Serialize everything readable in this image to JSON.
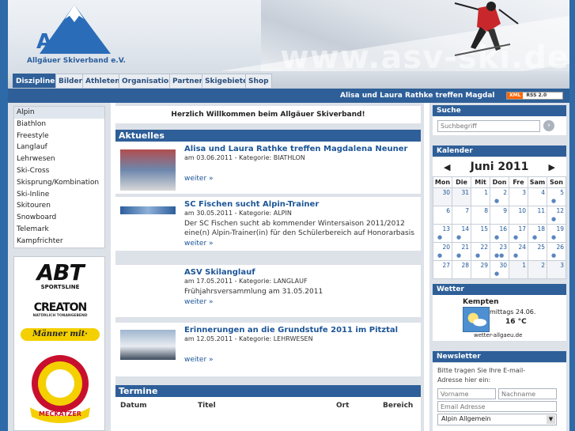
{
  "logo": {
    "abbr": "ASV",
    "subtitle": "Allgäuer Skiverband e.V."
  },
  "header": {
    "watermark": "www.asv-ski.de"
  },
  "nav": {
    "tabs": [
      "Disziplinen",
      "Bilder",
      "Athleten",
      "Organisation",
      "Partner",
      "Skigebiete",
      "Shop"
    ],
    "active": "Disziplinen"
  },
  "ticker": {
    "text": "Alisa und Laura Rathke treffen Magdalena Neuner"
  },
  "rss": {
    "xml": "XML",
    "label": "RSS 2.0"
  },
  "categories": [
    "Alpin",
    "Biathlon",
    "Freestyle",
    "Langlauf",
    "Lehrwesen",
    "Ski-Cross",
    "Skisprung/Kombination",
    "Ski-Inline",
    "Skitouren",
    "Snowboard",
    "Telemark",
    "Kampfrichter"
  ],
  "sponsors": {
    "abt": "ABT",
    "abt_sub": "SPORTSLINE",
    "creaton": "CREATON",
    "creaton_sub": "NATÜRLICH TONANGEBEND",
    "maenner": "Männer mit·",
    "meckatzer": "MECKATZER"
  },
  "welcome": "Herzlich Willkommen beim Allgäuer Skiverband!",
  "aktuelles": {
    "heading": "Aktuelles",
    "more_label": "weiter »",
    "articles": [
      {
        "title": "Alisa und Laura Rathke treffen Magdalena Neuner",
        "meta": "am 03.06.2011 - Kategorie: BIATHLON",
        "text": ""
      },
      {
        "title": "SC Fischen sucht Alpin-Trainer",
        "meta": "am 30.05.2011 - Kategorie: ALPIN",
        "text": "Der SC Fischen sucht ab kommender Wintersaison 2011/2012 eine(n) Alpin-Trainer(in) für den Schülerbereich auf Honorarbasis"
      },
      {
        "title": "ASV Skilanglauf",
        "meta": "am 17.05.2011 - Kategorie: LANGLAUF",
        "text": "Frühjahrsversammlung am 31.05.2011"
      },
      {
        "title": "Erinnerungen an die Grundstufe 2011 im Pitztal",
        "meta": "am 12.05.2011 - Kategorie: LEHRWESEN",
        "text": ""
      }
    ]
  },
  "termine": {
    "heading": "Termine",
    "columns": [
      "Datum",
      "Titel",
      "Ort",
      "Bereich"
    ]
  },
  "suche": {
    "heading": "Suche",
    "placeholder": "Suchbegriff",
    "button_icon": "go-arrow-icon"
  },
  "kalender": {
    "heading": "Kalender",
    "month": "Juni 2011",
    "prev": "◀",
    "next": "▶",
    "weekdays": [
      "Mon",
      "Die",
      "Mit",
      "Don",
      "Fre",
      "Sam",
      "Son"
    ],
    "weeks": [
      [
        {
          "d": "30",
          "m": true,
          "e": ""
        },
        {
          "d": "31",
          "m": true,
          "e": ""
        },
        {
          "d": "1",
          "e": ""
        },
        {
          "d": "2",
          "e": "●"
        },
        {
          "d": "3",
          "e": ""
        },
        {
          "d": "4",
          "e": ""
        },
        {
          "d": "5",
          "e": "●"
        }
      ],
      [
        {
          "d": "6",
          "e": ""
        },
        {
          "d": "7",
          "e": ""
        },
        {
          "d": "8",
          "e": ""
        },
        {
          "d": "9",
          "e": ""
        },
        {
          "d": "10",
          "e": ""
        },
        {
          "d": "11",
          "e": ""
        },
        {
          "d": "12",
          "e": "●"
        }
      ],
      [
        {
          "d": "13",
          "e": "●"
        },
        {
          "d": "14",
          "e": "●"
        },
        {
          "d": "15",
          "e": ""
        },
        {
          "d": "16",
          "e": "●"
        },
        {
          "d": "17",
          "e": "●"
        },
        {
          "d": "18",
          "e": "●"
        },
        {
          "d": "19",
          "e": "●"
        }
      ],
      [
        {
          "d": "20",
          "e": "●"
        },
        {
          "d": "21",
          "e": "●"
        },
        {
          "d": "22",
          "e": "●"
        },
        {
          "d": "23",
          "e": "●●"
        },
        {
          "d": "24",
          "e": "●"
        },
        {
          "d": "25",
          "e": ""
        },
        {
          "d": "26",
          "e": "●"
        }
      ],
      [
        {
          "d": "27",
          "e": ""
        },
        {
          "d": "28",
          "e": ""
        },
        {
          "d": "29",
          "e": ""
        },
        {
          "d": "30",
          "e": "●"
        },
        {
          "d": "1",
          "m": true,
          "e": ""
        },
        {
          "d": "2",
          "m": true,
          "e": ""
        },
        {
          "d": "3",
          "m": true,
          "e": ""
        }
      ]
    ]
  },
  "wetter": {
    "heading": "Wetter",
    "city": "Kempten",
    "date": "mittags 24.06.",
    "temp": "16 °C",
    "source": "wetter-allgaeu.de"
  },
  "newsletter": {
    "heading": "Newsletter",
    "text": "Bitte tragen Sie Ihre E-mail-Adresse hier ein:",
    "firstname": "Vorname",
    "lastname": "Nachname",
    "email": "Email Adresse",
    "select": "Alpin Allgemein"
  },
  "colors": {
    "brand": "#2e5f98",
    "link": "#1c5597"
  }
}
